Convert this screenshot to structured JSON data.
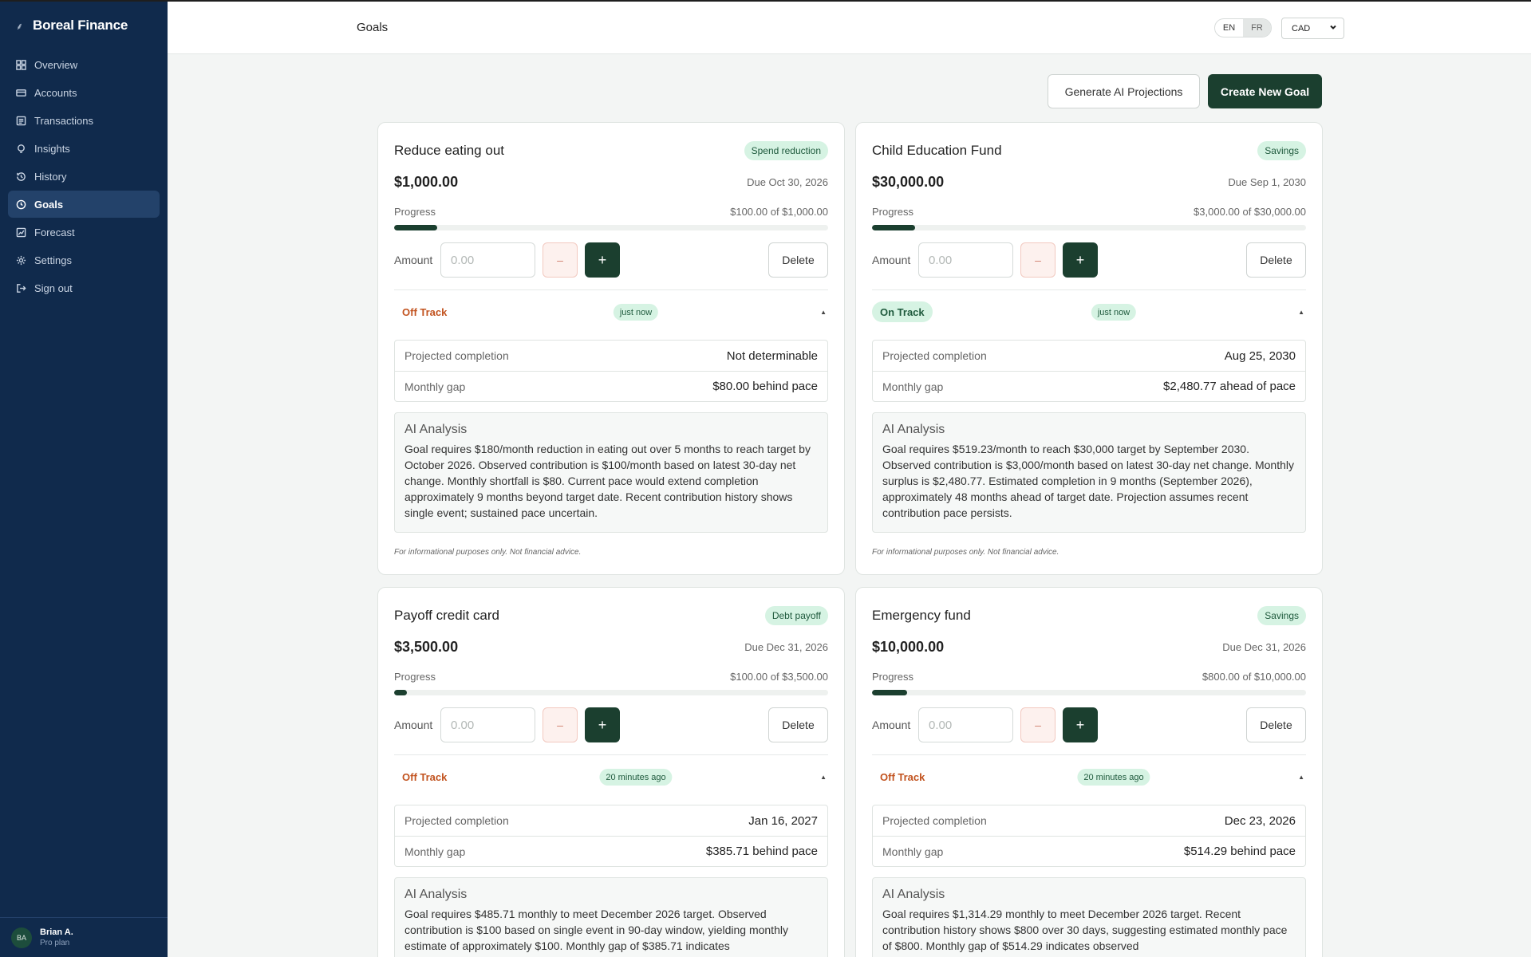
{
  "brand": {
    "name": "Boreal Finance"
  },
  "nav": [
    {
      "label": "Overview",
      "icon": "grid-icon"
    },
    {
      "label": "Accounts",
      "icon": "card-icon"
    },
    {
      "label": "Transactions",
      "icon": "list-icon"
    },
    {
      "label": "Insights",
      "icon": "bulb-icon"
    },
    {
      "label": "History",
      "icon": "history-icon"
    },
    {
      "label": "Goals",
      "icon": "target-icon",
      "active": true
    },
    {
      "label": "Forecast",
      "icon": "chart-icon"
    },
    {
      "label": "Settings",
      "icon": "gear-icon"
    },
    {
      "label": "Sign out",
      "icon": "signout-icon"
    }
  ],
  "user": {
    "initials": "BA",
    "name": "Brian A.",
    "plan": "Pro plan"
  },
  "header": {
    "title": "Goals",
    "lang_en": "EN",
    "lang_fr": "FR",
    "currency": "CAD"
  },
  "actions": {
    "ai_projections": "Generate AI Projections",
    "create_goal": "Create New Goal"
  },
  "labels": {
    "progress": "Progress",
    "amount": "Amount",
    "amount_placeholder": "0.00",
    "minus": "–",
    "plus": "+",
    "delete": "Delete",
    "projected_completion": "Projected completion",
    "monthly_gap": "Monthly gap",
    "ai_analysis": "AI Analysis",
    "disclaimer": "For informational purposes only. Not financial advice.",
    "caret": "▲"
  },
  "goals": [
    {
      "title": "Reduce eating out",
      "tag": "Spend reduction",
      "amount": "$1,000.00",
      "due": "Due Oct 30, 2026",
      "progress_text": "$100.00 of $1,000.00",
      "progress": 0.1,
      "status": "Off Track",
      "status_kind": "off",
      "updated": "just now",
      "projected": "Not determinable",
      "gap": "$80.00 behind pace",
      "analysis": "Goal requires $180/month reduction in eating out over 5 months to reach target by October 2026. Observed contribution is $100/month based on latest 30-day net change. Monthly shortfall is $80. Current pace would extend completion approximately 9 months beyond target date. Recent contribution history shows single event; sustained pace uncertain."
    },
    {
      "title": "Child Education Fund",
      "tag": "Savings",
      "amount": "$30,000.00",
      "due": "Due Sep 1, 2030",
      "progress_text": "$3,000.00 of $30,000.00",
      "progress": 0.1,
      "status": "On Track",
      "status_kind": "on",
      "updated": "just now",
      "projected": "Aug 25, 2030",
      "gap": "$2,480.77 ahead of pace",
      "analysis": "Goal requires $519.23/month to reach $30,000 target by September 2030. Observed contribution is $3,000/month based on latest 30-day net change. Monthly surplus is $2,480.77. Estimated completion in 9 months (September 2026), approximately 48 months ahead of target date. Projection assumes recent contribution pace persists."
    },
    {
      "title": "Payoff credit card",
      "tag": "Debt payoff",
      "amount": "$3,500.00",
      "due": "Due Dec 31, 2026",
      "progress_text": "$100.00 of $3,500.00",
      "progress": 0.0286,
      "status": "Off Track",
      "status_kind": "off",
      "updated": "20 minutes ago",
      "projected": "Jan 16, 2027",
      "gap": "$385.71 behind pace",
      "analysis": "Goal requires $485.71 monthly to meet December 2026 target. Observed contribution is $100 based on single event in 90-day window, yielding monthly estimate of approximately $100. Monthly gap of $385.71 indicates"
    },
    {
      "title": "Emergency fund",
      "tag": "Savings",
      "amount": "$10,000.00",
      "due": "Due Dec 31, 2026",
      "progress_text": "$800.00 of $10,000.00",
      "progress": 0.08,
      "status": "Off Track",
      "status_kind": "off",
      "updated": "20 minutes ago",
      "projected": "Dec 23, 2026",
      "gap": "$514.29 behind pace",
      "analysis": "Goal requires $1,314.29 monthly to meet December 2026 target. Recent contribution history shows $800 over 30 days, suggesting estimated monthly pace of $800. Monthly gap of $514.29 indicates observed"
    }
  ]
}
